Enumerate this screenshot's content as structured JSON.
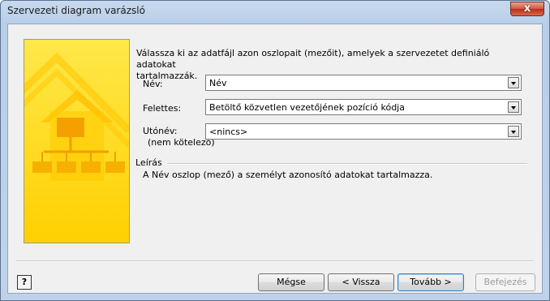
{
  "window": {
    "title": "Szervezeti diagram varázsló",
    "close_label": "x"
  },
  "intro_text_line1": "Válassza ki az adatfájl azon oszlopait (mezőit), amelyek a szervezetet definiáló adatokat",
  "intro_text_line2": "tartalmazzák.",
  "fields": {
    "nev": {
      "label": "Név:",
      "value": "Név"
    },
    "felettes": {
      "label": "Felettes:",
      "value": "Betöltő közvetlen vezetőjének pozíció kódja"
    },
    "utonev": {
      "label": "Utónév:",
      "sublabel": "(nem kötelező)",
      "value": "<nincs>"
    }
  },
  "description": {
    "title": "Leírás",
    "text": "A Név oszlop (mező) a személyt azonosító adatokat tartalmazza."
  },
  "buttons": {
    "help": "?",
    "cancel": "Mégse",
    "back": "< Vissza",
    "next": "Tovább >",
    "finish": "Befejezés"
  },
  "colors": {
    "banner_top": "#ffe030",
    "banner_bottom": "#ffd400",
    "accent": "#f5a800"
  }
}
